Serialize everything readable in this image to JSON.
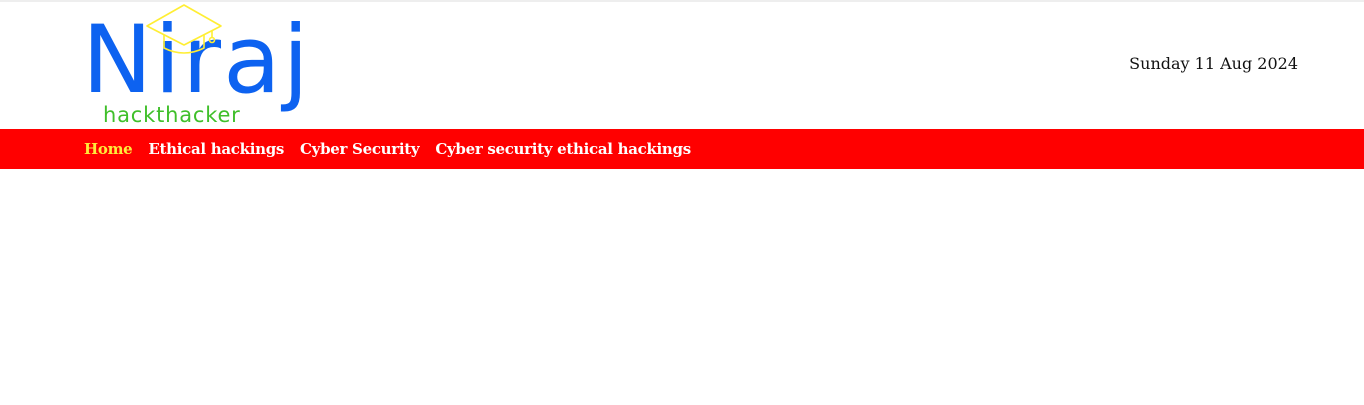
{
  "header": {
    "logo": {
      "word": "Niraj",
      "tagline": "hackthacker",
      "word_color": "#0d62f0",
      "tagline_color": "#3fbf2a",
      "cap_color": "#ffee33",
      "cap_icon": "graduation-cap-icon"
    },
    "date": "Sunday 11 Aug 2024"
  },
  "nav": {
    "background": "#ff0000",
    "active_color": "#ffeb3b",
    "items": [
      {
        "label": "Home",
        "active": true
      },
      {
        "label": "Ethical hackings",
        "active": false
      },
      {
        "label": "Cyber Security",
        "active": false
      },
      {
        "label": "Cyber security ethical hackings",
        "active": false
      }
    ]
  }
}
